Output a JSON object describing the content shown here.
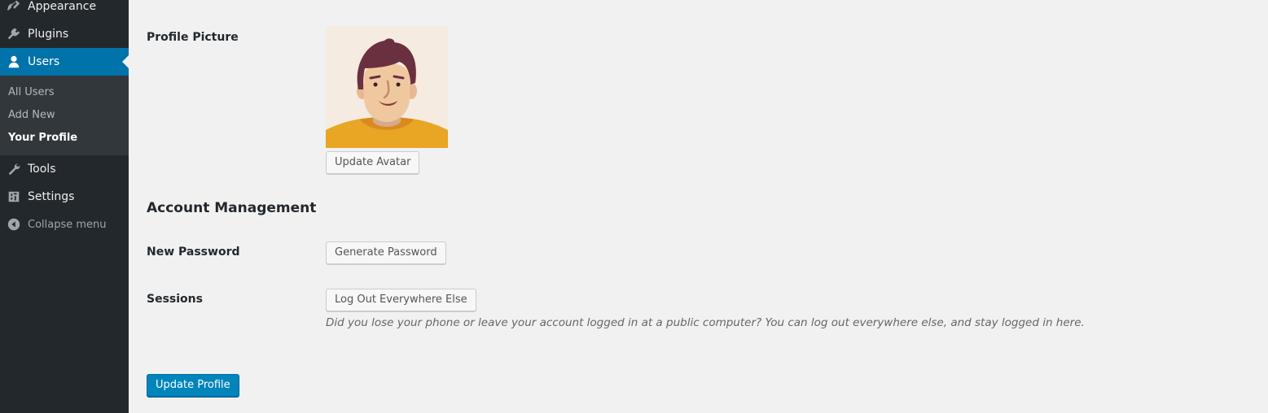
{
  "sidebar": {
    "items": [
      {
        "label": "Appearance",
        "icon": "paintbrush-icon"
      },
      {
        "label": "Plugins",
        "icon": "plugin-icon"
      },
      {
        "label": "Users",
        "icon": "user-icon"
      },
      {
        "label": "Tools",
        "icon": "wrench-icon"
      },
      {
        "label": "Settings",
        "icon": "settings-icon"
      },
      {
        "label": "Collapse menu",
        "icon": "collapse-icon"
      }
    ],
    "submenu": [
      {
        "label": "All Users"
      },
      {
        "label": "Add New"
      },
      {
        "label": "Your Profile"
      }
    ]
  },
  "profile": {
    "picture_label": "Profile Picture",
    "update_avatar_label": "Update Avatar"
  },
  "account": {
    "heading": "Account Management",
    "new_password_label": "New Password",
    "generate_password_label": "Generate Password",
    "sessions_label": "Sessions",
    "logout_everywhere_label": "Log Out Everywhere Else",
    "sessions_description": "Did you lose your phone or leave your account logged in at a public computer? You can log out everywhere else, and stay logged in here."
  },
  "actions": {
    "update_profile_label": "Update Profile"
  },
  "colors": {
    "sidebar_bg": "#23282d",
    "submenu_bg": "#32373c",
    "active_bg": "#0073aa",
    "primary_button": "#0085ba",
    "page_bg": "#f1f1f1"
  }
}
